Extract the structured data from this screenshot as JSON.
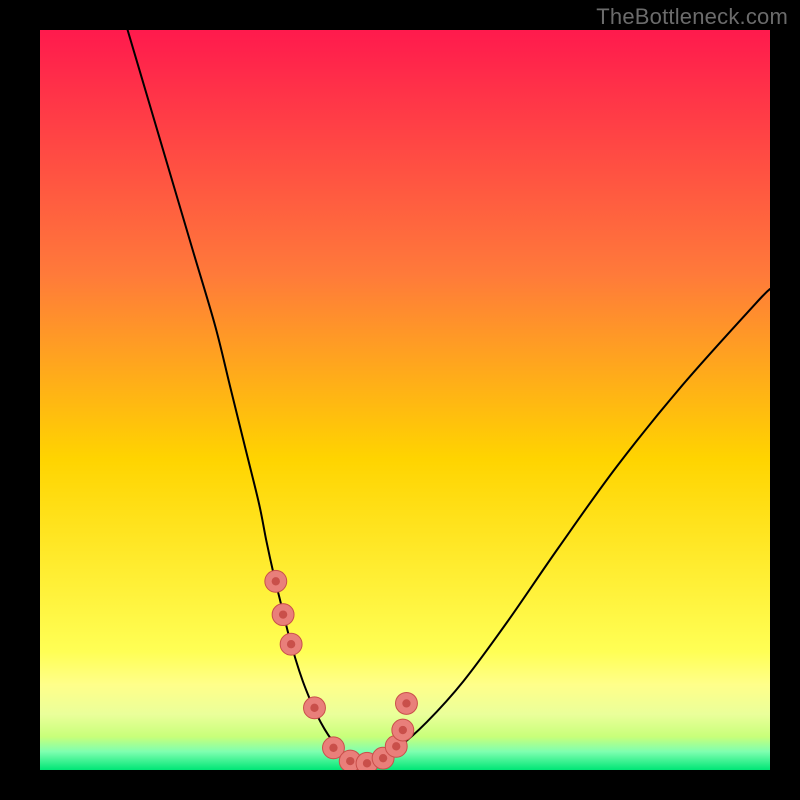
{
  "watermark": "TheBottleneck.com",
  "palette": {
    "top": "#ff1a4d",
    "mid": "#ffd400",
    "band_top": "#ffff8a",
    "band_mid": "#c8ff7a",
    "bottom": "#00e676",
    "curve": "#000000",
    "ring_fill": "#e97f7a",
    "ring_stroke": "#c94f4a"
  },
  "chart_data": {
    "type": "line",
    "title": "",
    "xlabel": "",
    "ylabel": "",
    "xlim": [
      0,
      100
    ],
    "ylim": [
      0,
      100
    ],
    "grid": false,
    "series": [
      {
        "name": "bottleneck-curve",
        "x": [
          12,
          15,
          18,
          21,
          24,
          26,
          28,
          30,
          31,
          32,
          33,
          34,
          35,
          36,
          37,
          38,
          39,
          40,
          41,
          42,
          44,
          46,
          49,
          53,
          58,
          64,
          71,
          79,
          88,
          98,
          100
        ],
        "y": [
          100,
          90,
          80,
          70,
          60,
          52,
          44,
          36,
          31,
          26.5,
          22.5,
          18.5,
          15,
          12,
          9.5,
          7.3,
          5.5,
          4,
          2.8,
          1.9,
          1,
          1.3,
          3,
          6.5,
          12,
          20,
          30,
          41,
          52,
          63,
          65
        ]
      }
    ],
    "markers": {
      "name": "highlight-points",
      "x": [
        32.3,
        33.3,
        34.4,
        37.6,
        40.2,
        42.5,
        44.8,
        47.0,
        48.8,
        49.7,
        50.2
      ],
      "y": [
        25.5,
        21.0,
        17.0,
        8.4,
        3.0,
        1.2,
        0.9,
        1.6,
        3.2,
        5.4,
        9.0
      ],
      "r": 1.5
    }
  }
}
